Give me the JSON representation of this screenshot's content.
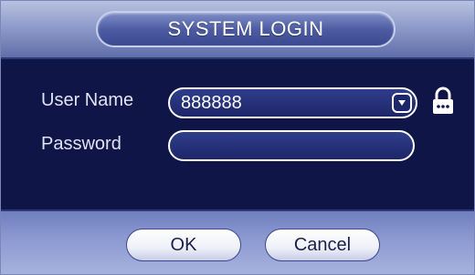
{
  "dialog": {
    "title": "SYSTEM LOGIN"
  },
  "form": {
    "username_label": "User Name",
    "username_value": "888888",
    "password_label": "Password",
    "password_value": ""
  },
  "icons": {
    "dropdown": "chevron-down-icon",
    "lock": "lock-icon"
  },
  "buttons": {
    "ok_label": "OK",
    "cancel_label": "Cancel"
  },
  "colors": {
    "background": "#101547",
    "title_bar": "#8f9ccb",
    "field_border": "#ffffff",
    "text": "#dfe3f5"
  }
}
